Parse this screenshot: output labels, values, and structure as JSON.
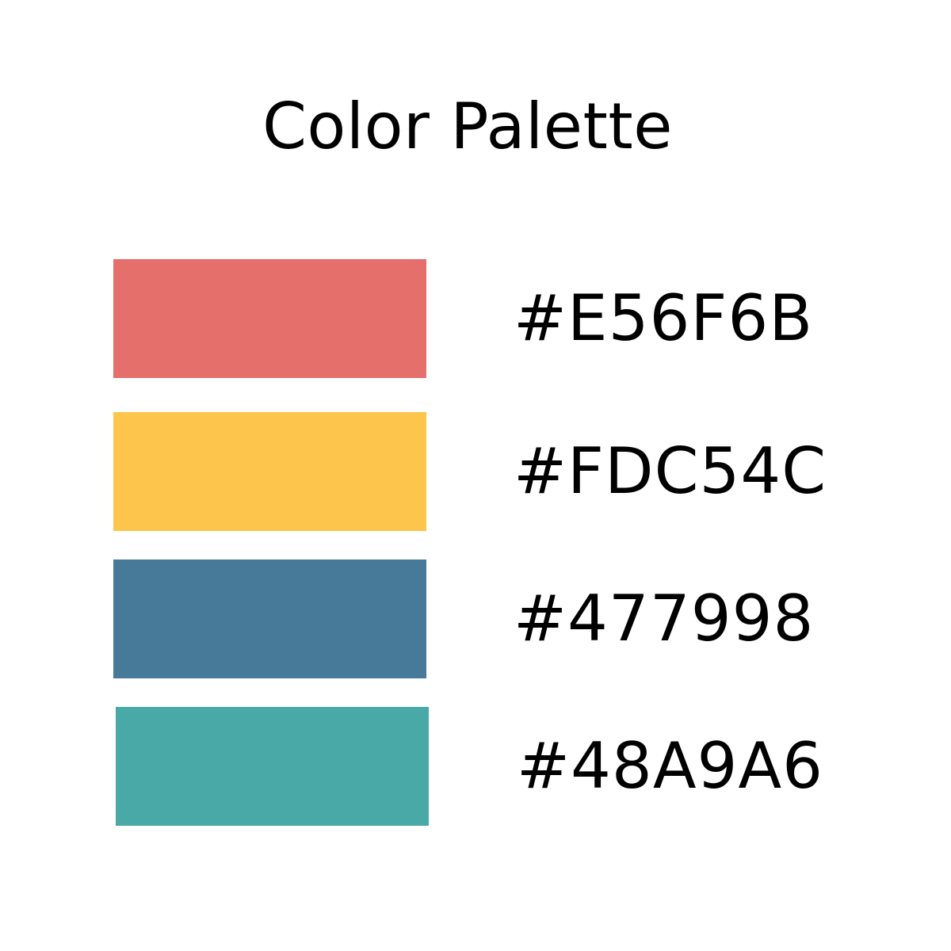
{
  "title": "Color Palette",
  "swatches": [
    {
      "hex": "#E56F6B",
      "color": "#E56F6B"
    },
    {
      "hex": "#FDC54C",
      "color": "#FDC54C"
    },
    {
      "hex": "#477998",
      "color": "#477998"
    },
    {
      "hex": "#48A9A6",
      "color": "#48A9A6"
    }
  ]
}
